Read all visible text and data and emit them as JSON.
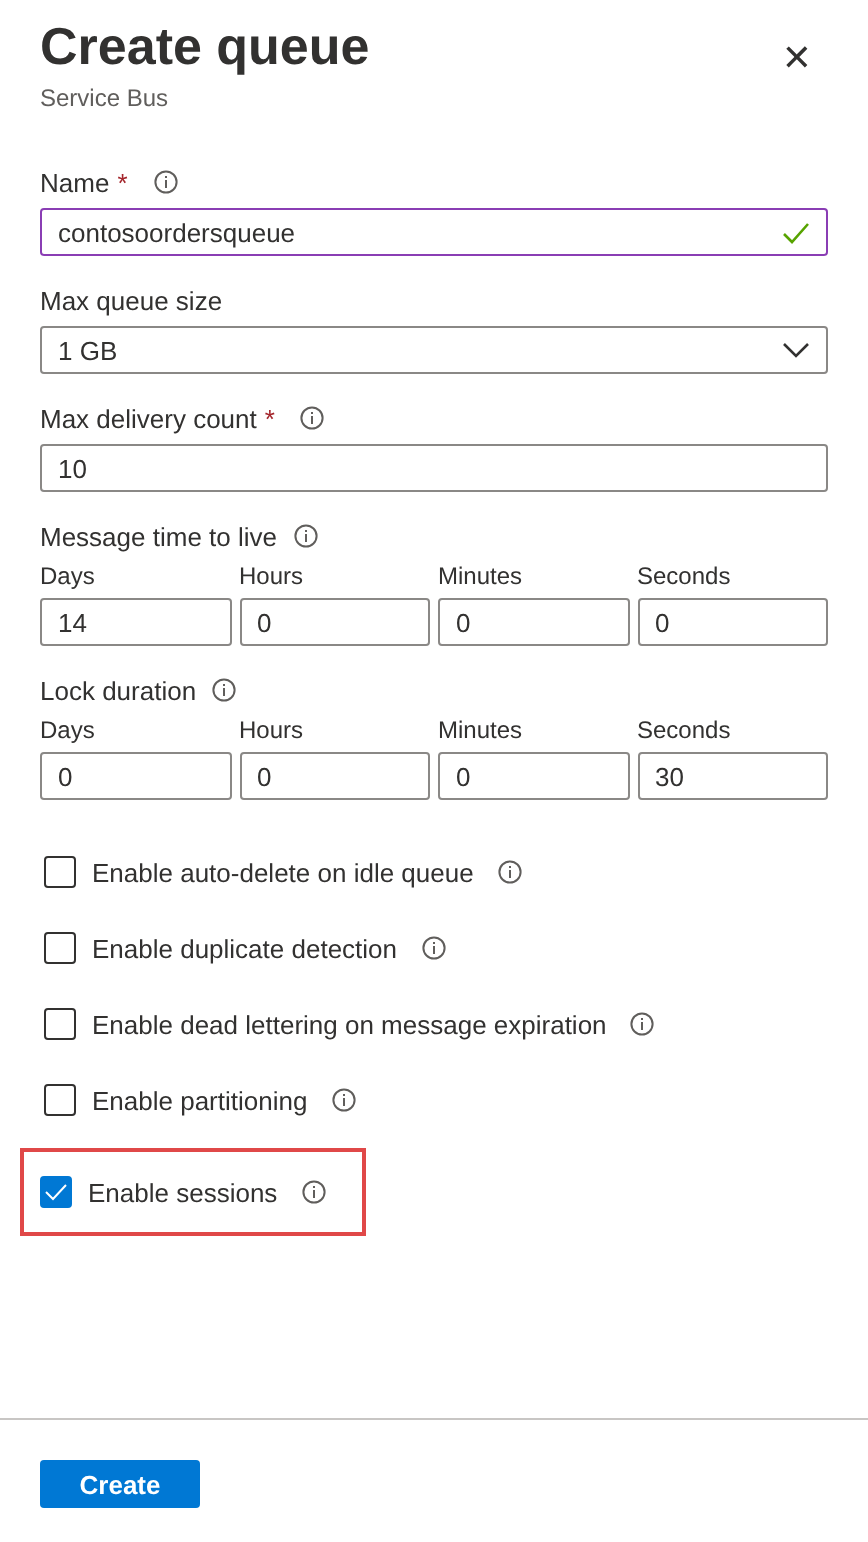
{
  "panel": {
    "title": "Create queue",
    "subtitle": "Service Bus",
    "close": "✕"
  },
  "fields": [
    {
      "kind": "text",
      "label": "Name",
      "required_mark": "*",
      "info": true,
      "value": "contosoordersqueue",
      "focused": true,
      "valid": true
    },
    {
      "kind": "select",
      "label": "Max queue size",
      "info": false,
      "value": "1 GB"
    },
    {
      "kind": "text",
      "label": "Max delivery count",
      "required_mark": "*",
      "info": true,
      "value": "10",
      "focused": false,
      "valid": false
    },
    {
      "kind": "duration",
      "label": "Message time to live",
      "info": true,
      "parts": [
        {
          "label": "Days",
          "value": "14"
        },
        {
          "label": "Hours",
          "value": "0"
        },
        {
          "label": "Minutes",
          "value": "0"
        },
        {
          "label": "Seconds",
          "value": "0"
        }
      ]
    },
    {
      "kind": "duration",
      "label": "Lock duration",
      "info": true,
      "parts": [
        {
          "label": "Days",
          "value": "0"
        },
        {
          "label": "Hours",
          "value": "0"
        },
        {
          "label": "Minutes",
          "value": "0"
        },
        {
          "label": "Seconds",
          "value": "30"
        }
      ]
    }
  ],
  "options": [
    {
      "label": "Enable auto-delete on idle queue",
      "checked": false,
      "highlighted": false
    },
    {
      "label": "Enable duplicate detection",
      "checked": false,
      "highlighted": false
    },
    {
      "label": "Enable dead lettering on message expiration",
      "checked": false,
      "highlighted": false
    },
    {
      "label": "Enable partitioning",
      "checked": false,
      "highlighted": false
    },
    {
      "label": "Enable sessions",
      "checked": true,
      "highlighted": true
    }
  ],
  "footer": {
    "button": "Create"
  }
}
